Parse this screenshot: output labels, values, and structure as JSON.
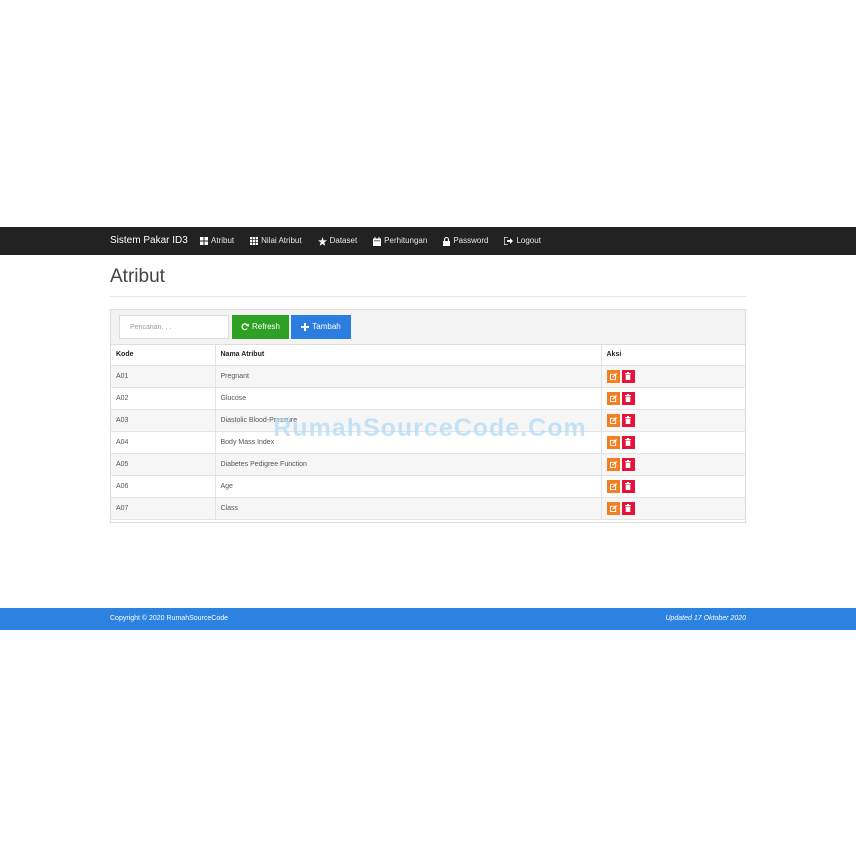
{
  "navbar": {
    "brand": "Sistem Pakar ID3",
    "items": [
      {
        "label": "Atribut",
        "icon": "grid-icon"
      },
      {
        "label": "Nilai Atribut",
        "icon": "list-grid-icon"
      },
      {
        "label": "Dataset",
        "icon": "star-icon"
      },
      {
        "label": "Perhitungan",
        "icon": "calendar-icon"
      },
      {
        "label": "Password",
        "icon": "lock-icon"
      },
      {
        "label": "Logout",
        "icon": "logout-icon"
      }
    ]
  },
  "page": {
    "title": "Atribut"
  },
  "toolbar": {
    "search_placeholder": "Pencarian. . .",
    "refresh_label": "Refresh",
    "tambah_label": "Tambah"
  },
  "table": {
    "headers": [
      "Kode",
      "Nama Atribut",
      "Aksi"
    ],
    "rows": [
      {
        "kode": "A01",
        "nama": "Pregnant"
      },
      {
        "kode": "A02",
        "nama": "Glucose"
      },
      {
        "kode": "A03",
        "nama": "Diastolic Blood-Pressure"
      },
      {
        "kode": "A04",
        "nama": "Body Mass Index"
      },
      {
        "kode": "A05",
        "nama": "Diabetes Pedigree Function"
      },
      {
        "kode": "A06",
        "nama": "Age"
      },
      {
        "kode": "A07",
        "nama": "Class"
      }
    ]
  },
  "watermark": "RumahSourceCode.Com",
  "footer": {
    "copyright": "Copyright © 2020 RumahSourceCode",
    "updated": "Updated 17 Oktober 2020"
  },
  "colors": {
    "navbar": "#222222",
    "refresh": "#2ea125",
    "tambah": "#2b7ee0",
    "edit": "#f08022",
    "delete": "#e6123a",
    "footer": "#2b82e0"
  }
}
